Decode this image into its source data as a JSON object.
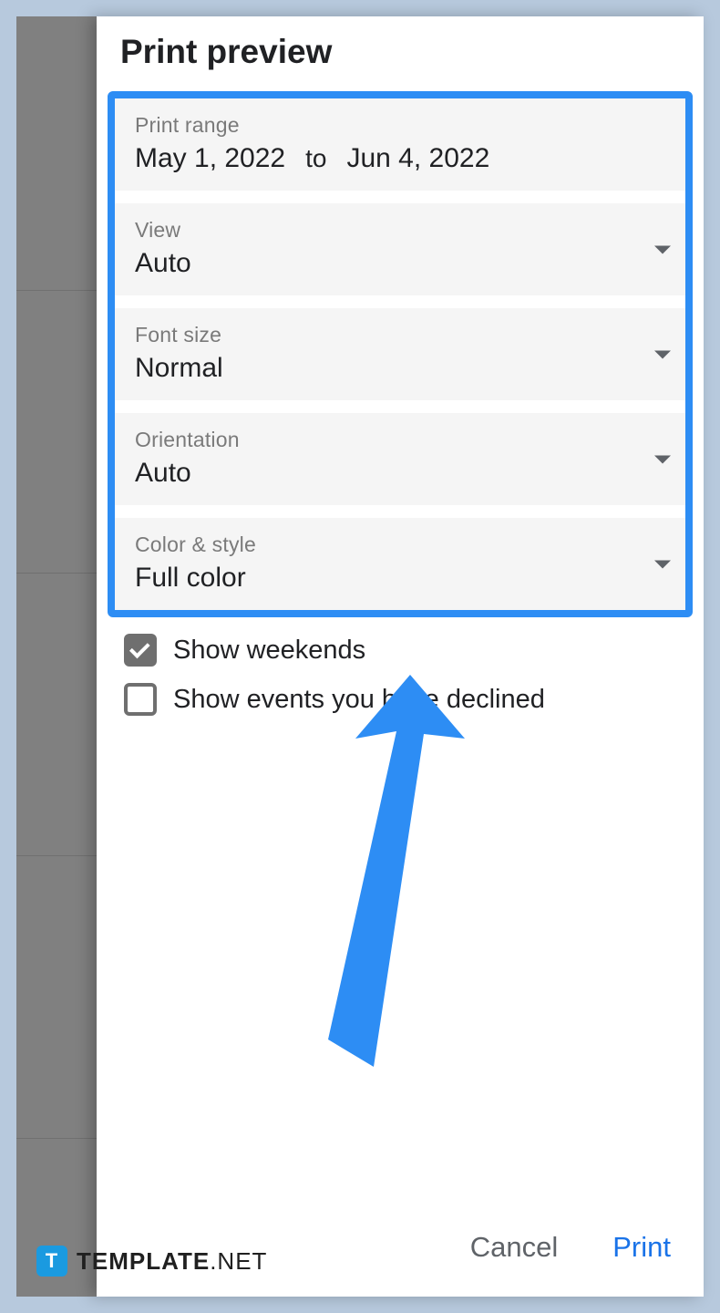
{
  "title": "Print preview",
  "printRange": {
    "label": "Print range",
    "start": "May 1, 2022",
    "separator": "to",
    "end": "Jun 4, 2022"
  },
  "view": {
    "label": "View",
    "value": "Auto"
  },
  "fontSize": {
    "label": "Font size",
    "value": "Normal"
  },
  "orientation": {
    "label": "Orientation",
    "value": "Auto"
  },
  "colorStyle": {
    "label": "Color & style",
    "value": "Full color"
  },
  "checkShowWeekends": {
    "label": "Show weekends",
    "checked": true
  },
  "checkShowDeclined": {
    "label": "Show events you have declined",
    "checked": false
  },
  "buttons": {
    "cancel": "Cancel",
    "print": "Print"
  },
  "watermark": {
    "badge": "T",
    "text1": "TEMPLATE",
    "text2": ".NET"
  },
  "annotationColor": "#2d8df4"
}
